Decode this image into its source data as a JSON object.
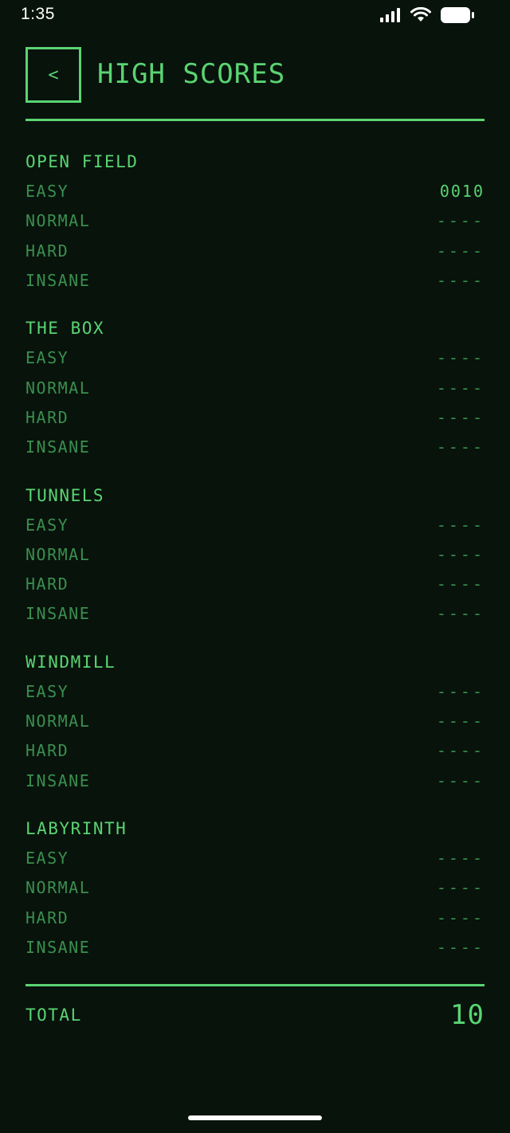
{
  "status_bar": {
    "time": "1:35"
  },
  "header": {
    "back_label": "<",
    "title": "HIGH SCORES"
  },
  "sections": [
    {
      "title": "OPEN FIELD",
      "rows": [
        {
          "label": "EASY",
          "score": "0010"
        },
        {
          "label": "NORMAL",
          "score": "----"
        },
        {
          "label": "HARD",
          "score": "----"
        },
        {
          "label": "INSANE",
          "score": "----"
        }
      ]
    },
    {
      "title": "THE BOX",
      "rows": [
        {
          "label": "EASY",
          "score": "----"
        },
        {
          "label": "NORMAL",
          "score": "----"
        },
        {
          "label": "HARD",
          "score": "----"
        },
        {
          "label": "INSANE",
          "score": "----"
        }
      ]
    },
    {
      "title": "TUNNELS",
      "rows": [
        {
          "label": "EASY",
          "score": "----"
        },
        {
          "label": "NORMAL",
          "score": "----"
        },
        {
          "label": "HARD",
          "score": "----"
        },
        {
          "label": "INSANE",
          "score": "----"
        }
      ]
    },
    {
      "title": "WINDMILL",
      "rows": [
        {
          "label": "EASY",
          "score": "----"
        },
        {
          "label": "NORMAL",
          "score": "----"
        },
        {
          "label": "HARD",
          "score": "----"
        },
        {
          "label": "INSANE",
          "score": "----"
        }
      ]
    },
    {
      "title": "LABYRINTH",
      "rows": [
        {
          "label": "EASY",
          "score": "----"
        },
        {
          "label": "NORMAL",
          "score": "----"
        },
        {
          "label": "HARD",
          "score": "----"
        },
        {
          "label": "INSANE",
          "score": "----"
        }
      ]
    }
  ],
  "total": {
    "label": "TOTAL",
    "value": "10"
  },
  "icons": {
    "signal": "cellular-signal-icon",
    "wifi": "wifi-icon",
    "battery": "battery-icon"
  },
  "colors": {
    "background": "#08130c",
    "accent": "#5ad472",
    "muted": "#3a8f4e"
  }
}
